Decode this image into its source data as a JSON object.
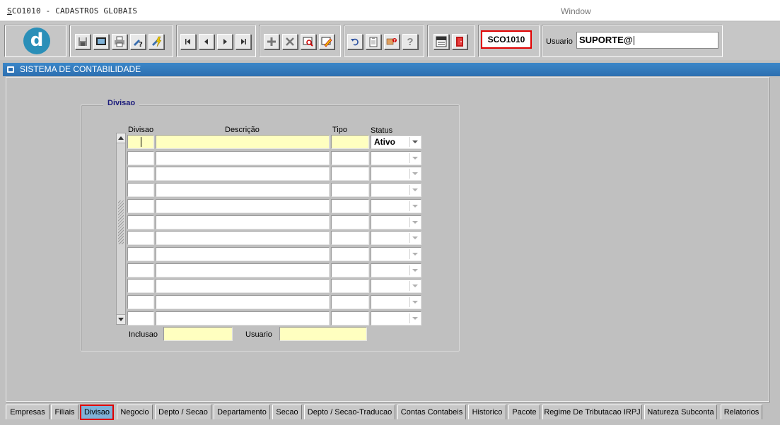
{
  "window": {
    "title_first": "S",
    "title_rest": "CO1010 - CADASTROS GLOBAIS",
    "menu_window": "Window"
  },
  "toolbar": {
    "logo_letter": "d",
    "form_code": "SCO1010",
    "user_label": "Usuario",
    "user_value": "SUPORTE@",
    "groups": [
      [
        "save-icon",
        "screen-icon",
        "print-icon",
        "query-help-icon",
        "execute-query-icon"
      ],
      [
        "first-record-icon",
        "prev-record-icon",
        "next-record-icon",
        "last-record-icon"
      ],
      [
        "insert-record-icon",
        "delete-record-icon",
        "find-icon",
        "edit-icon"
      ],
      [
        "undo-icon",
        "clipboard-icon",
        "help-hand-icon",
        "help-question-icon"
      ],
      [
        "menu-icon",
        "exit-icon"
      ]
    ],
    "menu_text": "Menu",
    "help_question_text": "?"
  },
  "system_bar": {
    "title": "SISTEMA DE CONTABILIDADE"
  },
  "form": {
    "group_title": "Divisao",
    "columns": {
      "divisao": "Divisao",
      "descricao": "Descrição",
      "tipo": "Tipo",
      "status": "Status"
    },
    "rows": [
      {
        "divisao": "",
        "descricao": "",
        "tipo": "",
        "status": "Ativo"
      },
      {
        "divisao": "",
        "descricao": "",
        "tipo": "",
        "status": ""
      },
      {
        "divisao": "",
        "descricao": "",
        "tipo": "",
        "status": ""
      },
      {
        "divisao": "",
        "descricao": "",
        "tipo": "",
        "status": ""
      },
      {
        "divisao": "",
        "descricao": "",
        "tipo": "",
        "status": ""
      },
      {
        "divisao": "",
        "descricao": "",
        "tipo": "",
        "status": ""
      },
      {
        "divisao": "",
        "descricao": "",
        "tipo": "",
        "status": ""
      },
      {
        "divisao": "",
        "descricao": "",
        "tipo": "",
        "status": ""
      },
      {
        "divisao": "",
        "descricao": "",
        "tipo": "",
        "status": ""
      },
      {
        "divisao": "",
        "descricao": "",
        "tipo": "",
        "status": ""
      },
      {
        "divisao": "",
        "descricao": "",
        "tipo": "",
        "status": ""
      },
      {
        "divisao": "",
        "descricao": "",
        "tipo": "",
        "status": ""
      }
    ],
    "inclusao_label": "Inclusao",
    "usuario_label": "Usuario"
  },
  "tabs": [
    {
      "label": "Empresas",
      "active": false
    },
    {
      "label": "Filiais",
      "active": false
    },
    {
      "label": "Divisao",
      "active": true
    },
    {
      "label": "Negocio",
      "active": false
    },
    {
      "label": "Depto / Secao",
      "active": false
    },
    {
      "label": "Departamento",
      "active": false
    },
    {
      "label": "Secao",
      "active": false
    },
    {
      "label": "Depto / Secao-Traducao",
      "active": false
    },
    {
      "label": "Contas Contabeis",
      "active": false
    },
    {
      "label": "Historico",
      "active": false
    },
    {
      "label": "Pacote",
      "active": false
    },
    {
      "label": "Regime De Tributacao IRPJ",
      "active": false
    },
    {
      "label": "Natureza Subconta",
      "active": false
    },
    {
      "label": "Relatorios",
      "active": false
    }
  ],
  "colors": {
    "accent_blue": "#2d6fb0",
    "required_yellow": "#ffffc0",
    "highlight_red": "#e00000",
    "active_tab": "#7fb2d8"
  }
}
